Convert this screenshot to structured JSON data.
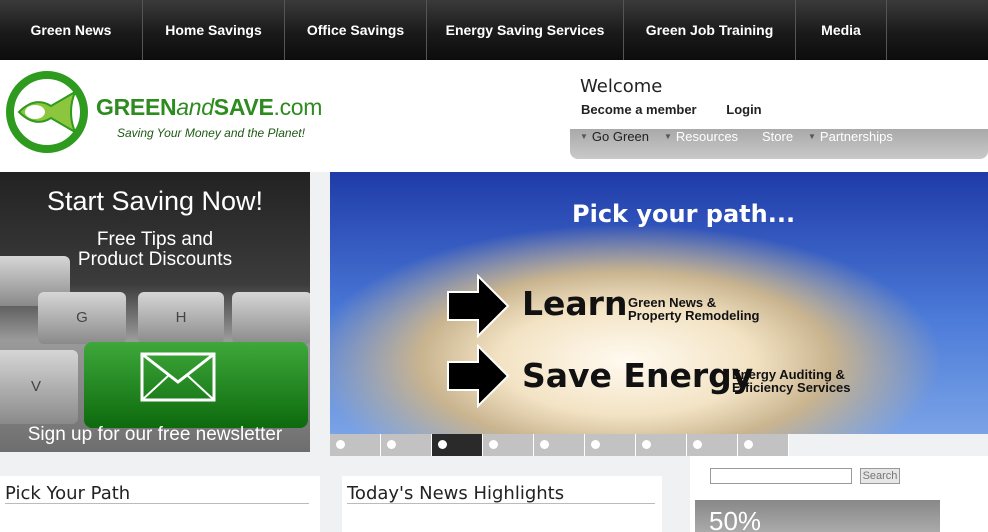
{
  "topnav": {
    "items": [
      {
        "label": "Green News"
      },
      {
        "label": "Home Savings"
      },
      {
        "label": "Office Savings"
      },
      {
        "label": "Energy Saving Services"
      },
      {
        "label": "Green Job Training"
      },
      {
        "label": "Media"
      }
    ]
  },
  "header": {
    "brand_green": "GREEN",
    "brand_and": "and",
    "brand_save": "SAVE",
    "brand_dotcom": ".com",
    "tagline": "Saving Your Money and the Planet!",
    "welcome": "Welcome",
    "become_member": "Become a member",
    "login": "Login"
  },
  "subnav": {
    "items": [
      "Go Green",
      "Resources",
      "Store",
      "Partnerships"
    ]
  },
  "promo": {
    "title": "Start Saving Now!",
    "sub1": "Free Tips and",
    "sub2": "Product Discounts",
    "footer": "Sign up for our free newsletter",
    "keys": [
      "G",
      "H",
      "V"
    ]
  },
  "hero": {
    "title": "Pick your path...",
    "learn": "Learn",
    "learn_sub1": "Green News &",
    "learn_sub2": "Property Remodeling",
    "save": "Save Energy",
    "save_sub1": "Energy Auditing &",
    "save_sub2": "Efficiency Services"
  },
  "slider": {
    "count": 9,
    "active_index": 2
  },
  "panels": {
    "pick_path": "Pick Your Path",
    "news": "Today's News Highlights"
  },
  "search": {
    "button": "Search",
    "value": ""
  },
  "offer": {
    "text": "50%"
  },
  "colors": {
    "brand_green": "#2e8b1f",
    "nav_dark": "#1a1a1a",
    "newsletter_green": "#2c9a2a"
  }
}
